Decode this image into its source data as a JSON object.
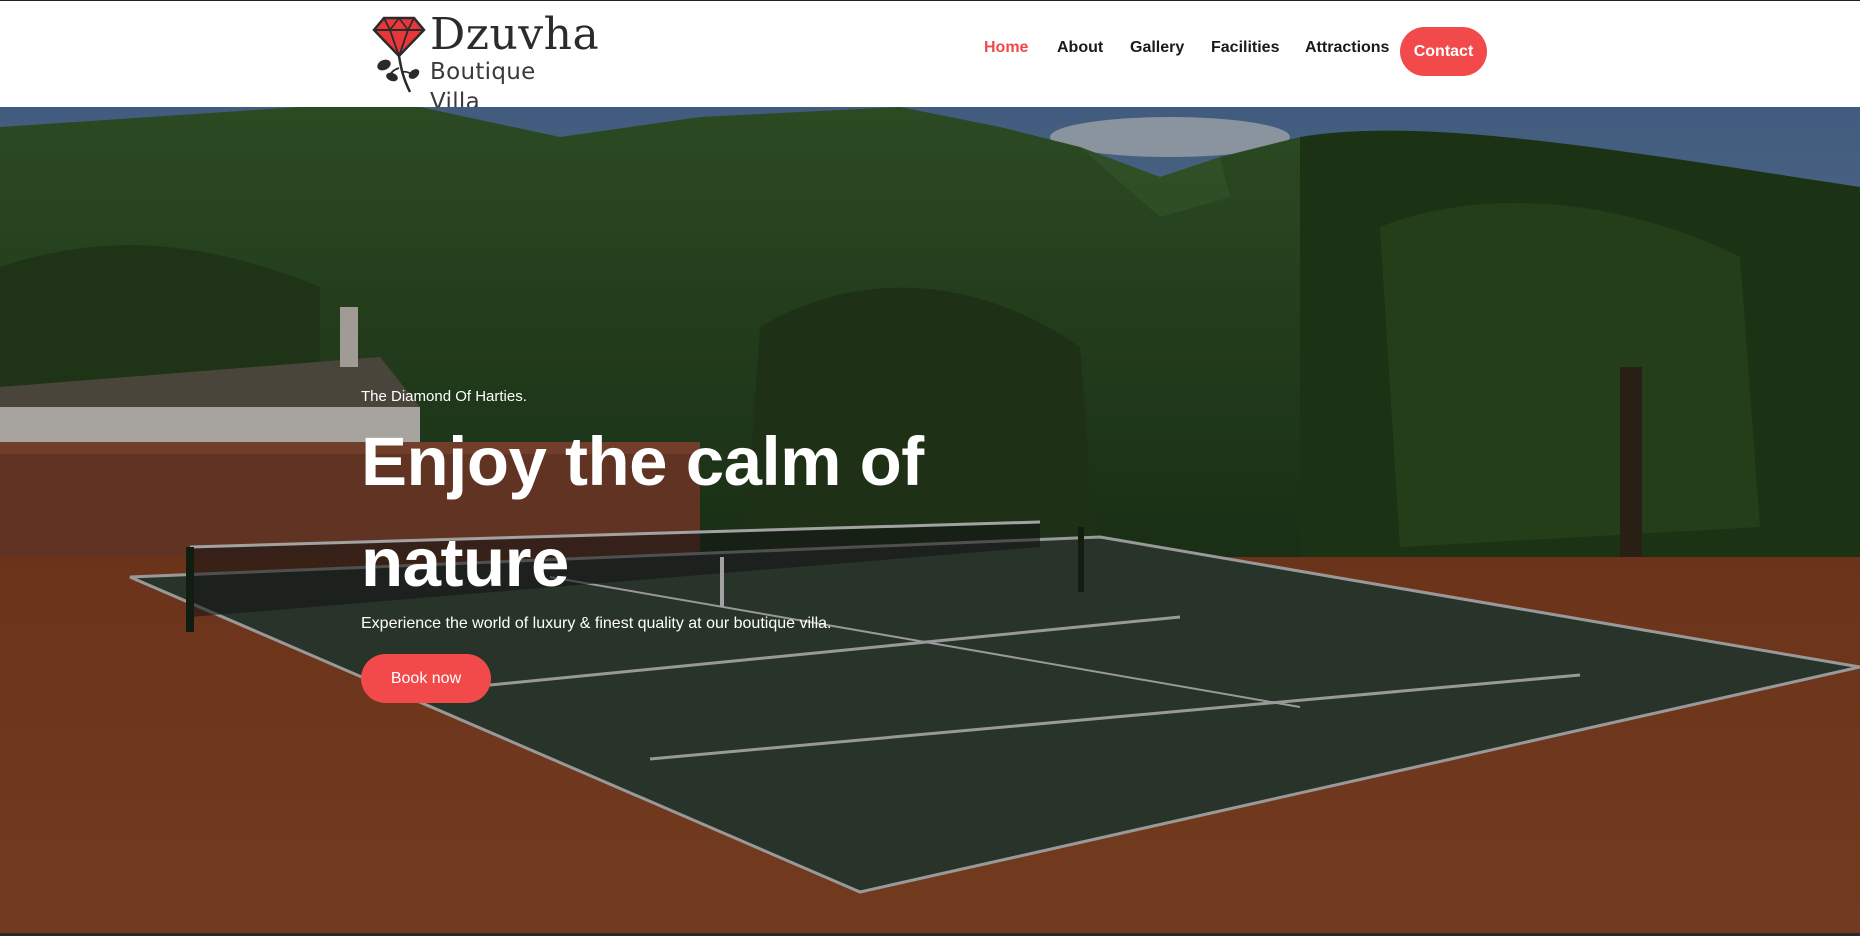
{
  "brand": {
    "name": "Dzuvha",
    "tagline": "Boutique Villa",
    "logo_icon": "diamond-rose-icon",
    "accent": "#f24a4a"
  },
  "nav": {
    "items": [
      {
        "label": "Home",
        "active": true
      },
      {
        "label": "About",
        "active": false
      },
      {
        "label": "Gallery",
        "active": false
      },
      {
        "label": "Facilities",
        "active": false
      },
      {
        "label": "Attractions",
        "active": false
      }
    ],
    "contact_label": "Contact"
  },
  "hero": {
    "eyebrow": "The Diamond Of Harties.",
    "headline": "Enjoy the calm of nature",
    "subtext": "Experience the world of luxury & finest quality at our boutique villa.",
    "cta_label": "Book now"
  }
}
